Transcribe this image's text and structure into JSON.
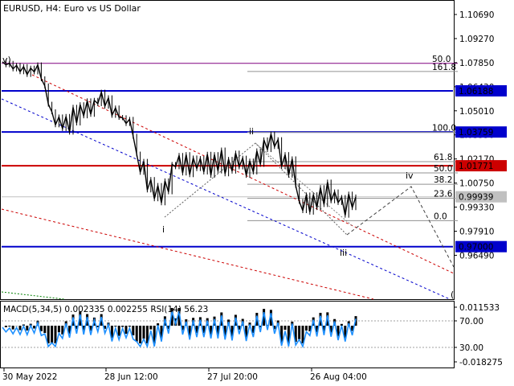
{
  "window": {
    "symbol": "EURUSD",
    "timeframe": "H4:",
    "description": "Euro vs US Dollar"
  },
  "chart_data": {
    "type": "line",
    "title": "EURUSD, H4:  Euro vs US Dollar",
    "ylim": [
      0.9395,
      1.1145
    ],
    "y_ticks": [
      "1.10690",
      "1.09270",
      "1.07850",
      "1.06430",
      "1.05010",
      "1.03590",
      "1.02170",
      "1.00750",
      "0.99330",
      "0.97910",
      "0.96490"
    ],
    "x_ticks": [
      "30 May 2022",
      "28 Jun 12:00",
      "27 Jul 20:00",
      "26 Aug 04:00"
    ],
    "series": [
      {
        "color": "#000000",
        "values": [
          1.079,
          1.0772,
          1.0781,
          1.0748,
          1.0769,
          1.0731,
          1.0762,
          1.0715,
          1.0753,
          1.073,
          1.0772,
          1.069,
          1.0648,
          1.054,
          1.0495,
          1.0418,
          1.0465,
          1.0396,
          1.0468,
          1.0375,
          1.0522,
          1.0429,
          1.0537,
          1.0471,
          1.056,
          1.048,
          1.0563,
          1.0543,
          1.0611,
          1.0528,
          1.0578,
          1.0474,
          1.0518,
          1.0462,
          1.046,
          1.0426,
          1.0451,
          1.0351,
          1.0246,
          1.0138,
          1.0203,
          1.0034,
          1.0096,
          0.9982,
          1.0061,
          0.9958,
          1.0088,
          1.0023,
          1.0185,
          1.0171,
          1.0238,
          1.0134,
          1.0243,
          1.0124,
          1.0223,
          1.016,
          1.022,
          1.014,
          1.0245,
          1.012,
          1.0243,
          1.0146,
          1.027,
          1.0129,
          1.0215,
          1.0145,
          1.0252,
          1.017,
          1.0222,
          1.012,
          1.0205,
          1.014,
          1.0265,
          1.0185,
          1.033,
          1.0272,
          1.0364,
          1.029,
          1.0331,
          1.0172,
          1.0243,
          1.0121,
          1.0218,
          1.006,
          0.9967,
          0.9912,
          1.0005,
          0.9903,
          1.0006,
          0.993,
          1.0048,
          0.9948,
          1.0081,
          0.997,
          1.0023,
          0.996,
          0.999,
          0.9885,
          1.001,
          0.993,
          0.9993
        ]
      }
    ],
    "indicator": {
      "name": "MACD(5,34,5)",
      "values": "0.002335 0.002255",
      "rsi_label": "RSI(14) 56.23",
      "ylim": [
        -0.018275,
        0.011533
      ],
      "y_ticks": [
        "0.011533",
        "70.00",
        "30.00",
        "-0.018275"
      ]
    }
  },
  "price_levels": [
    {
      "label": "1.06188",
      "value": 1.06188,
      "color": "#0000cc"
    },
    {
      "label": "1.03759",
      "value": 1.03759,
      "color": "#0000cc"
    },
    {
      "label": "1.01771",
      "value": 1.01771,
      "color": "#cc0000"
    },
    {
      "label": "0.99939",
      "value": 0.99939,
      "color": "#c0c0c0"
    },
    {
      "label": "0.97000",
      "value": 0.97,
      "color": "#0000cc"
    }
  ],
  "fibo": {
    "upper": [
      {
        "label": "161.8",
        "value": 1.0733
      },
      {
        "label": "100.0",
        "value": 1.0375
      },
      {
        "label": "50.0",
        "value": 1.0781
      }
    ],
    "lower": [
      {
        "label": "61.8",
        "value": 1.0201
      },
      {
        "label": "50.0",
        "value": 1.0135
      },
      {
        "label": "38.2",
        "value": 1.0068
      },
      {
        "label": "23.6",
        "value": 0.9985
      },
      {
        "label": "0.0",
        "value": 0.9853
      }
    ]
  },
  "waves": [
    {
      "label": "v)",
      "color": "#cc0000"
    },
    {
      "label": "i",
      "color": "#404040"
    },
    {
      "label": "ii",
      "color": "#808080"
    },
    {
      "label": "iii",
      "color": "#808080"
    },
    {
      "label": "iv",
      "color": "#808080"
    },
    {
      "label": "(",
      "color": "#cc0000"
    }
  ],
  "colors": {
    "background": "#ffffff",
    "price_line": "#000000",
    "support_resistance": "#0000cc",
    "key_level": "#cc0000",
    "channel_blue": "#0000cc",
    "channel_red": "#cc0000",
    "rsi": "#1e90ff",
    "macd_hist": "#000000"
  }
}
